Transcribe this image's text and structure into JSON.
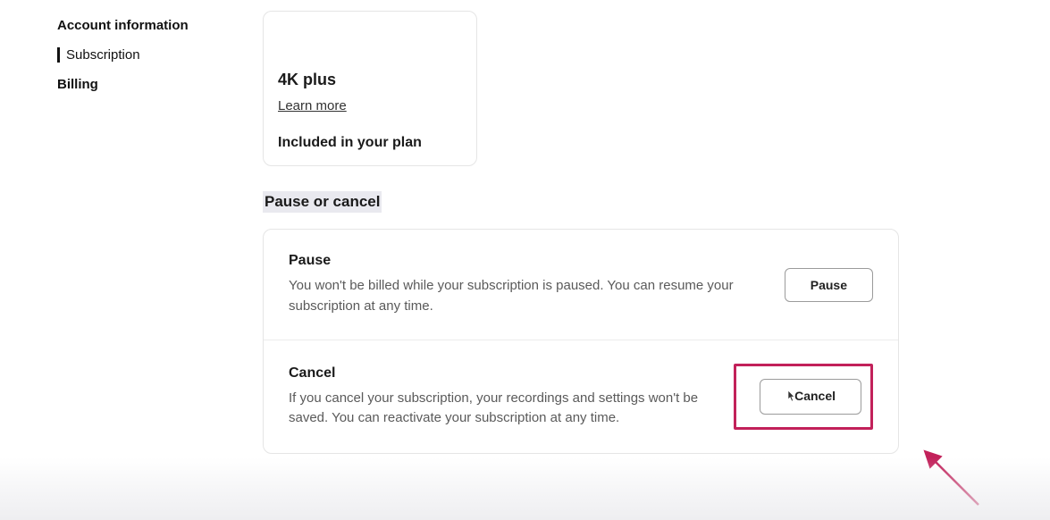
{
  "sidebar": {
    "items": [
      {
        "label": "Account information"
      },
      {
        "label": "Subscription"
      },
      {
        "label": "Billing"
      }
    ]
  },
  "plan": {
    "title": "4K plus",
    "learn_more": "Learn more",
    "included": "Included in your plan"
  },
  "pause_cancel": {
    "heading": "Pause or cancel",
    "pause": {
      "title": "Pause",
      "desc": "You won't be billed while your subscription is paused. You can resume your subscription at any time.",
      "button": "Pause"
    },
    "cancel": {
      "title": "Cancel",
      "desc": "If you cancel your subscription, your recordings and settings won't be saved. You can reactivate your subscription at any time.",
      "button": "Cancel"
    }
  }
}
